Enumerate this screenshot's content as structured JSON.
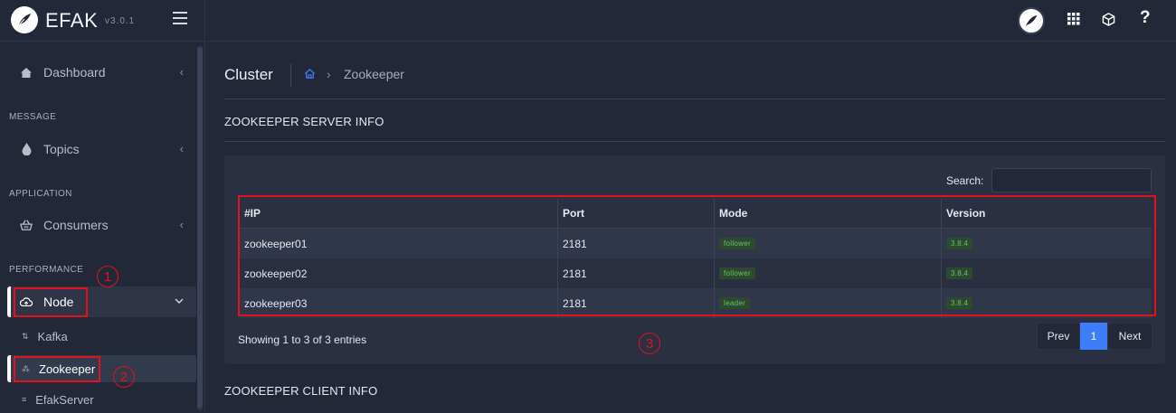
{
  "brand": {
    "name": "EFAK",
    "version": "v3.0.1"
  },
  "sidebar": {
    "dashboard": "Dashboard",
    "section_message": "MESSAGE",
    "topics": "Topics",
    "section_application": "APPLICATION",
    "consumers": "Consumers",
    "section_performance": "PERFORMANCE",
    "node": "Node",
    "sub_items": [
      "Kafka",
      "Zookeeper",
      "EfakServer"
    ]
  },
  "annotations": [
    "1",
    "2",
    "3"
  ],
  "header": {
    "help": "?"
  },
  "breadcrumb": {
    "title": "Cluster",
    "current": "Zookeeper"
  },
  "server_info": {
    "title": "ZOOKEEPER SERVER INFO",
    "search_label": "Search:",
    "search_value": "",
    "columns": [
      "#IP",
      "Port",
      "Mode",
      "Version"
    ],
    "rows": [
      {
        "ip": "zookeeper01",
        "port": "2181",
        "mode": "follower",
        "version": "3.8.4"
      },
      {
        "ip": "zookeeper02",
        "port": "2181",
        "mode": "follower",
        "version": "3.8.4"
      },
      {
        "ip": "zookeeper03",
        "port": "2181",
        "mode": "leader",
        "version": "3.8.4"
      }
    ],
    "showing": "Showing 1 to 3 of 3 entries",
    "pager": {
      "prev": "Prev",
      "current": "1",
      "next": "Next"
    }
  },
  "client_info": {
    "title": "ZOOKEEPER CLIENT INFO"
  },
  "colors": {
    "accent": "#3d7df7",
    "annotation_red": "#e0121a",
    "badge_green": "#66c36a"
  }
}
